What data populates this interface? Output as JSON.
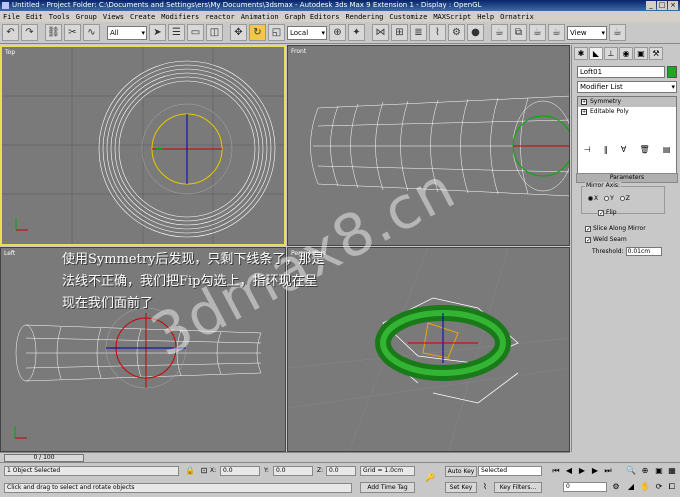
{
  "window": {
    "title": "Untitled    - Project Folder: C:\\Documents and Settings\\ers\\My Documents\\3dsmax    - Autodesk 3ds Max 9 Extension 1    - Display : OpenGL",
    "minimize": "_",
    "maximize": "□",
    "close": "×"
  },
  "menu": [
    "File",
    "Edit",
    "Tools",
    "Group",
    "Views",
    "Create",
    "Modifiers",
    "reactor",
    "Animation",
    "Graph Editors",
    "Rendering",
    "Customize",
    "MAXScript",
    "Help",
    "Ornatrix"
  ],
  "toolbar": {
    "selection_filter": "All",
    "coord_system": "Local",
    "view_dropdown": "View"
  },
  "viewports": {
    "top": "Top",
    "front": "Front",
    "left": "Left",
    "perspective": "Perspective"
  },
  "overlay": {
    "line1": "使用Symmetry后发现，只剩下线条了，那是",
    "line2": "法线不正确，我们把Fip勾选上，指环现在呈",
    "line3": "现在我们面前了",
    "watermark": "3dmax8.cn"
  },
  "command_panel": {
    "object_name": "Loft01",
    "object_color": "#1fa81f",
    "modifier_list": "Modifier List",
    "stack": [
      "Symmetry",
      "Editable Poly"
    ],
    "rollout_title": "Parameters",
    "mirror_axis_label": "Mirror Axis:",
    "axes": [
      "X",
      "Y",
      "Z"
    ],
    "selected_axis": "X",
    "flip_label": "Flip",
    "slice_label": "Slice Along Mirror",
    "weld_label": "Weld Seam",
    "threshold_label": "Threshold:",
    "threshold_value": "0.01cm"
  },
  "timeline": {
    "frame": "0 / 100"
  },
  "status": {
    "selection": "1 Object Selected",
    "prompt": "Click and drag to select and rotate objects",
    "x_label": "X:",
    "x_value": "0.0",
    "y_label": "Y:",
    "y_value": "0.0",
    "z_label": "Z:",
    "z_value": "0.0",
    "grid": "Grid = 1.0cm",
    "add_time_tag": "Add Time Tag",
    "auto_key": "Auto Key",
    "set_key": "Set Key",
    "key_mode": "Selected",
    "key_filters": "Key Filters...",
    "current_frame": "0"
  }
}
